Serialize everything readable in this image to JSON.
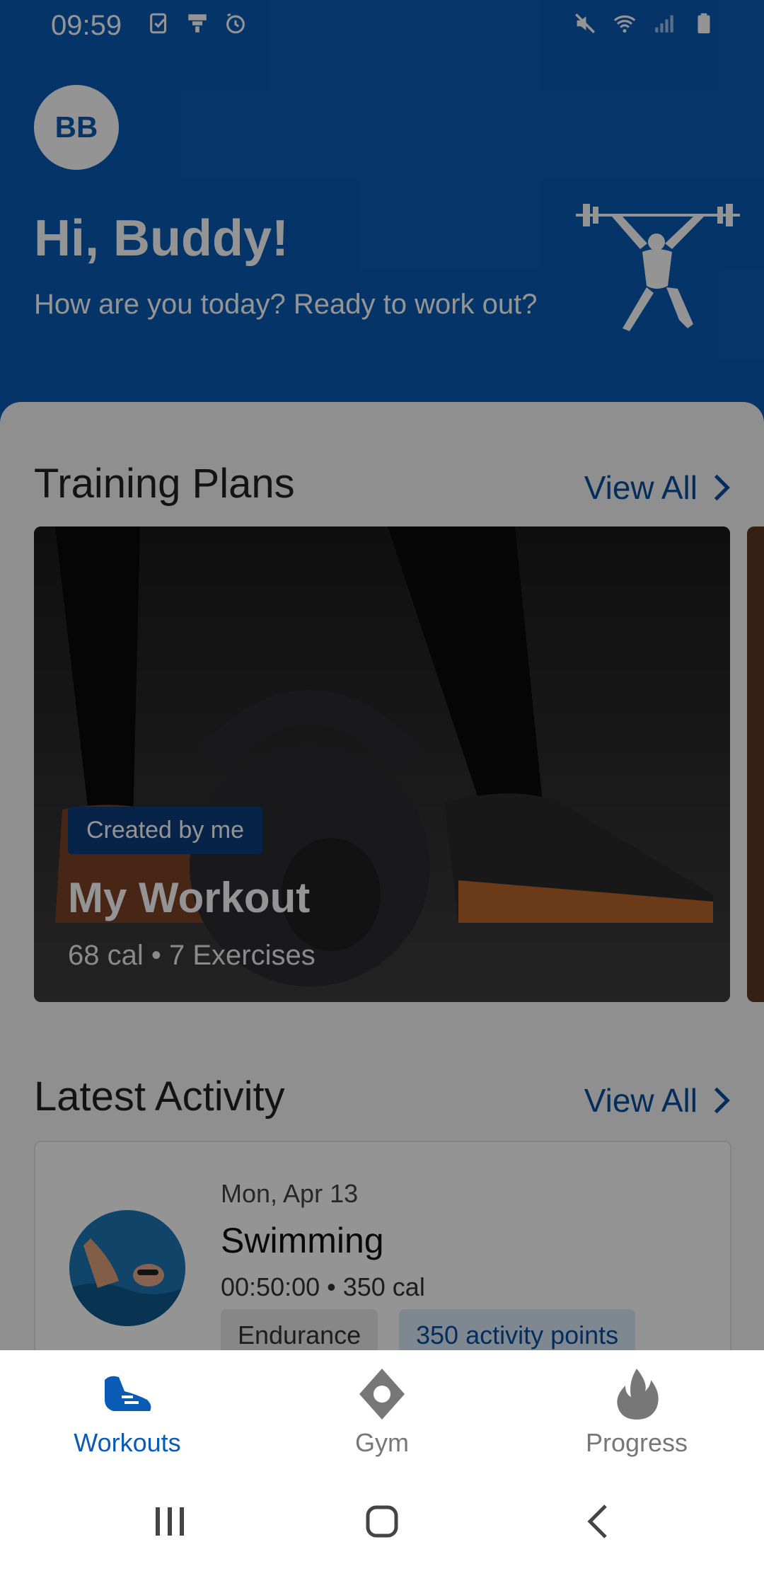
{
  "status_bar": {
    "time": "09:59",
    "left_icons": [
      "task-icon",
      "notification-icon",
      "alarm-icon"
    ],
    "right_icons": [
      "mute-icon",
      "wifi-icon",
      "signal-icon",
      "battery-icon"
    ]
  },
  "header": {
    "avatar_initials": "BB",
    "greeting": "Hi, Buddy!",
    "subtitle": "How are you today? Ready to work out?",
    "illustration": "weightlifter-icon"
  },
  "training_plans": {
    "title": "Training Plans",
    "view_all": "View All",
    "cards": [
      {
        "badge": "Created by me",
        "title": "My Workout",
        "meta": "68 cal • 7 Exercises"
      }
    ]
  },
  "latest_activity": {
    "title": "Latest Activity",
    "view_all": "View All",
    "items": [
      {
        "date": "Mon, Apr 13",
        "name": "Swimming",
        "stats": "00:50:00 • 350 cal",
        "tags": [
          "Endurance",
          "350 activity points"
        ]
      }
    ]
  },
  "bottom_nav": {
    "items": [
      {
        "label": "Workouts",
        "icon": "shoe-icon",
        "active": true
      },
      {
        "label": "Gym",
        "icon": "location-icon",
        "active": false
      },
      {
        "label": "Progress",
        "icon": "flame-icon",
        "active": false
      }
    ]
  },
  "colors": {
    "brand": "#0a5bb5",
    "badge": "#0d3d7a",
    "link": "#0a4f9e"
  }
}
